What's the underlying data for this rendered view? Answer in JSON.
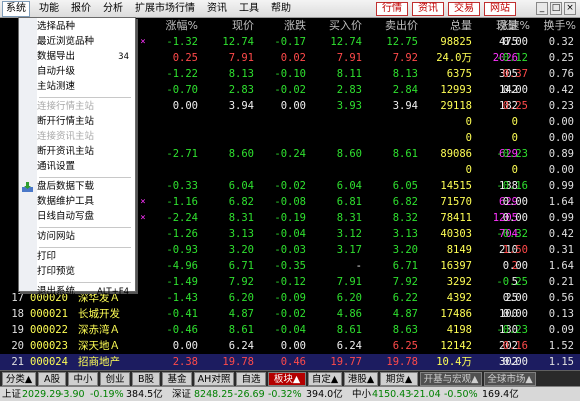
{
  "menubar": {
    "items": [
      "系统",
      "功能",
      "报价",
      "分析",
      "扩展市场行情",
      "资讯",
      "工具",
      "帮助"
    ],
    "quick": [
      "行情",
      "资讯",
      "交易",
      "网站"
    ],
    "window_buttons": [
      "_",
      "□",
      "×"
    ]
  },
  "table": {
    "headers": [
      "涨幅%",
      "现价",
      "涨跌",
      "买入价",
      "卖出价",
      "总量",
      "现量",
      "涨速%",
      "换手%"
    ],
    "rows": [
      {
        "idx": "",
        "code": "",
        "name": "",
        "mark": "×",
        "pct": "-1.32",
        "price": "12.74",
        "chg": "-0.17",
        "bid": "12.74",
        "ask": "12.75",
        "vol": "98825",
        "cur": "475",
        "speed": "0.00",
        "turn": "0.32",
        "colors": {
          "pct": "green",
          "price": "green",
          "chg": "green",
          "bid": "green",
          "ask": "green",
          "cur": "white",
          "speed": "white"
        }
      },
      {
        "idx": "",
        "code": "",
        "name": "",
        "mark": "",
        "pct": "0.25",
        "price": "7.91",
        "chg": "0.02",
        "bid": "7.91",
        "ask": "7.92",
        "vol": "24.0万",
        "cur": "2026",
        "speed": "-0.12",
        "turn": "0.25",
        "colors": {
          "pct": "red",
          "price": "red",
          "chg": "red",
          "bid": "red",
          "ask": "red",
          "cur": "magenta",
          "speed": "green"
        }
      },
      {
        "idx": "",
        "code": "",
        "name": "",
        "mark": "",
        "pct": "-1.22",
        "price": "8.13",
        "chg": "-0.10",
        "bid": "8.11",
        "ask": "8.13",
        "vol": "6375",
        "cur": "305",
        "speed": "0.37",
        "turn": "0.76",
        "colors": {
          "pct": "green",
          "price": "green",
          "chg": "green",
          "bid": "green",
          "ask": "green",
          "cur": "white",
          "speed": "red"
        }
      },
      {
        "idx": "",
        "code": "",
        "name": "",
        "mark": "",
        "pct": "-0.70",
        "price": "2.83",
        "chg": "-0.02",
        "bid": "2.83",
        "ask": "2.84",
        "vol": "12993",
        "cur": "142",
        "speed": "0.00",
        "turn": "0.42",
        "colors": {
          "pct": "green",
          "price": "green",
          "chg": "green",
          "bid": "green",
          "ask": "green",
          "cur": "white",
          "speed": "white"
        }
      },
      {
        "idx": "",
        "code": "",
        "name": "",
        "mark": "",
        "pct": "0.00",
        "price": "3.94",
        "chg": "0.00",
        "bid": "3.93",
        "ask": "3.94",
        "vol": "29118",
        "cur": "182",
        "speed": "0.25",
        "turn": "0.23",
        "colors": {
          "pct": "white",
          "price": "white",
          "chg": "white",
          "bid": "green",
          "ask": "white",
          "cur": "white",
          "speed": "red"
        }
      },
      {
        "idx": "",
        "code": "",
        "name": "",
        "mark": "",
        "pct": "",
        "price": "",
        "chg": "",
        "bid": "",
        "ask": "",
        "vol": "0",
        "cur": "0",
        "speed": "",
        "turn": "0.00",
        "colors": {
          "cur": "yellow"
        }
      },
      {
        "idx": "",
        "code": "",
        "name": "",
        "mark": "",
        "pct": "",
        "price": "",
        "chg": "",
        "bid": "",
        "ask": "",
        "vol": "0",
        "cur": "0",
        "speed": "",
        "turn": "0.00",
        "colors": {
          "cur": "yellow"
        }
      },
      {
        "idx": "",
        "code": "",
        "name": "",
        "mark": "",
        "pct": "-2.71",
        "price": "8.60",
        "chg": "-0.24",
        "bid": "8.60",
        "ask": "8.61",
        "vol": "89086",
        "cur": "629",
        "speed": "-0.23",
        "turn": "0.89",
        "colors": {
          "pct": "green",
          "price": "green",
          "chg": "green",
          "bid": "green",
          "ask": "green",
          "cur": "magenta",
          "speed": "green"
        }
      },
      {
        "idx": "",
        "code": "",
        "name": "",
        "mark": "",
        "pct": "",
        "price": "",
        "chg": "",
        "bid": "",
        "ask": "",
        "vol": "0",
        "cur": "0",
        "speed": "",
        "turn": "0.00",
        "colors": {
          "cur": "yellow"
        }
      },
      {
        "idx": "",
        "code": "",
        "name": "",
        "mark": "",
        "pct": "-0.33",
        "price": "6.04",
        "chg": "-0.02",
        "bid": "6.04",
        "ask": "6.05",
        "vol": "14515",
        "cur": "138",
        "speed": "-0.16",
        "turn": "0.99",
        "colors": {
          "pct": "green",
          "price": "green",
          "chg": "green",
          "bid": "green",
          "ask": "green",
          "cur": "white",
          "speed": "green"
        }
      },
      {
        "idx": "",
        "code": "",
        "name": "",
        "mark": "×",
        "pct": "-1.16",
        "price": "6.82",
        "chg": "-0.08",
        "bid": "6.81",
        "ask": "6.82",
        "vol": "71570",
        "cur": "629",
        "speed": "0.00",
        "turn": "1.64",
        "colors": {
          "pct": "green",
          "price": "green",
          "chg": "green",
          "bid": "green",
          "ask": "green",
          "cur": "magenta",
          "speed": "white"
        }
      },
      {
        "idx": "",
        "code": "",
        "name": "",
        "mark": "×",
        "pct": "-2.24",
        "price": "8.31",
        "chg": "-0.19",
        "bid": "8.31",
        "ask": "8.32",
        "vol": "78411",
        "cur": "1205",
        "speed": "0.00",
        "turn": "0.99",
        "colors": {
          "pct": "green",
          "price": "green",
          "chg": "green",
          "bid": "green",
          "ask": "green",
          "cur": "magenta",
          "speed": "white"
        }
      },
      {
        "idx": "",
        "code": "",
        "name": "",
        "mark": "",
        "pct": "-1.26",
        "price": "3.13",
        "chg": "-0.04",
        "bid": "3.12",
        "ask": "3.13",
        "vol": "40303",
        "cur": "704",
        "speed": "-0.32",
        "turn": "0.42",
        "colors": {
          "pct": "green",
          "price": "green",
          "chg": "green",
          "bid": "green",
          "ask": "green",
          "cur": "magenta",
          "speed": "green"
        }
      },
      {
        "idx": "",
        "code": "",
        "name": "",
        "mark": "",
        "pct": "-0.93",
        "price": "3.20",
        "chg": "-0.03",
        "bid": "3.17",
        "ask": "3.20",
        "vol": "8149",
        "cur": "210",
        "speed": "1.50",
        "turn": "0.31",
        "colors": {
          "pct": "green",
          "price": "green",
          "chg": "green",
          "bid": "green",
          "ask": "green",
          "cur": "white",
          "speed": "red"
        }
      },
      {
        "idx": "",
        "code": "",
        "name": "",
        "mark": "",
        "pct": "-4.96",
        "price": "6.71",
        "chg": "-0.35",
        "bid": "-",
        "ask": "6.71",
        "vol": "16397",
        "cur": "2",
        "speed": "0.00",
        "turn": "1.64",
        "colors": {
          "pct": "green",
          "price": "green",
          "chg": "green",
          "bid": "white",
          "ask": "green",
          "cur": "red",
          "speed": "white"
        }
      },
      {
        "idx": "",
        "code": "",
        "name": "",
        "mark": "",
        "pct": "-1.49",
        "price": "7.92",
        "chg": "-0.12",
        "bid": "7.91",
        "ask": "7.92",
        "vol": "3292",
        "cur": "5",
        "speed": "-0.25",
        "turn": "0.21",
        "colors": {
          "pct": "green",
          "price": "green",
          "chg": "green",
          "bid": "green",
          "ask": "green",
          "cur": "white",
          "speed": "green"
        }
      },
      {
        "idx": "17",
        "code": "000020",
        "name": "深华发Ａ",
        "mark": "",
        "pct": "-1.43",
        "price": "6.20",
        "chg": "-0.09",
        "bid": "6.20",
        "ask": "6.22",
        "vol": "4392",
        "cur": "25",
        "speed": "0.00",
        "turn": "0.56",
        "colors": {
          "pct": "green",
          "price": "green",
          "chg": "green",
          "bid": "green",
          "ask": "green",
          "cur": "white",
          "speed": "white"
        }
      },
      {
        "idx": "18",
        "code": "000021",
        "name": "长城开发",
        "mark": "",
        "pct": "-0.41",
        "price": "4.87",
        "chg": "-0.02",
        "bid": "4.86",
        "ask": "4.87",
        "vol": "17486",
        "cur": "100",
        "speed": "0.00",
        "turn": "0.13",
        "colors": {
          "pct": "green",
          "price": "green",
          "chg": "green",
          "bid": "green",
          "ask": "green",
          "cur": "white",
          "speed": "white"
        }
      },
      {
        "idx": "19",
        "code": "000022",
        "name": "深赤湾Ａ",
        "mark": "",
        "pct": "-0.46",
        "price": "8.61",
        "chg": "-0.04",
        "bid": "8.61",
        "ask": "8.63",
        "vol": "4198",
        "cur": "130",
        "speed": "-0.23",
        "turn": "0.09",
        "colors": {
          "pct": "green",
          "price": "green",
          "chg": "green",
          "bid": "green",
          "ask": "green",
          "cur": "white",
          "speed": "green"
        }
      },
      {
        "idx": "20",
        "code": "000023",
        "name": "深天地Ａ",
        "mark": "",
        "pct": "0.00",
        "price": "6.24",
        "chg": "0.00",
        "bid": "6.24",
        "ask": "6.25",
        "vol": "12142",
        "cur": "202",
        "speed": "0.16",
        "turn": "1.52",
        "colors": {
          "pct": "white",
          "price": "white",
          "chg": "white",
          "bid": "white",
          "ask": "red",
          "cur": "white",
          "speed": "red"
        }
      },
      {
        "idx": "21",
        "code": "000024",
        "name": "招商地产",
        "mark": "",
        "pct": "2.38",
        "price": "19.78",
        "chg": "0.46",
        "bid": "19.77",
        "ask": "19.78",
        "vol": "10.4万",
        "cur": "302",
        "speed": "0.00",
        "turn": "1.15",
        "colors": {
          "pct": "red",
          "price": "red",
          "chg": "red",
          "bid": "red",
          "ask": "red",
          "cur": "white",
          "speed": "white"
        }
      }
    ]
  },
  "dropdown": {
    "items": [
      {
        "label": "选择品种",
        "shortcut": "",
        "disabled": false,
        "icon": ""
      },
      {
        "label": "最近浏览品种",
        "shortcut": "",
        "disabled": false,
        "icon": ""
      },
      {
        "label": "数据导出",
        "shortcut": "34",
        "disabled": false,
        "icon": ""
      },
      {
        "label": "自动升级",
        "shortcut": "",
        "disabled": false,
        "icon": ""
      },
      {
        "label": "主站测速",
        "shortcut": "",
        "disabled": false,
        "icon": ""
      },
      {
        "sep": true
      },
      {
        "label": "连接行情主站",
        "shortcut": "",
        "disabled": true,
        "icon": ""
      },
      {
        "label": "断开行情主站",
        "shortcut": "",
        "disabled": false,
        "icon": ""
      },
      {
        "label": "连接资讯主站",
        "shortcut": "",
        "disabled": true,
        "icon": ""
      },
      {
        "label": "断开资讯主站",
        "shortcut": "",
        "disabled": false,
        "icon": ""
      },
      {
        "label": "通讯设置",
        "shortcut": "",
        "disabled": false,
        "icon": ""
      },
      {
        "sep": true
      },
      {
        "label": "盘后数据下载",
        "shortcut": "",
        "disabled": false,
        "icon": "download"
      },
      {
        "label": "数据维护工具",
        "shortcut": "",
        "disabled": false,
        "icon": ""
      },
      {
        "label": "日线自动写盘",
        "shortcut": "",
        "disabled": false,
        "icon": ""
      },
      {
        "sep": true
      },
      {
        "label": "访问网站",
        "shortcut": "",
        "disabled": false,
        "icon": ""
      },
      {
        "sep": true
      },
      {
        "label": "打印",
        "shortcut": "",
        "disabled": false,
        "icon": ""
      },
      {
        "label": "打印预览",
        "shortcut": "",
        "disabled": false,
        "icon": ""
      },
      {
        "sep": true
      },
      {
        "label": "退出系统",
        "shortcut": "ALT+F4",
        "disabled": false,
        "icon": ""
      }
    ]
  },
  "tabs": [
    {
      "label": "分类▲",
      "style": ""
    },
    {
      "label": "A股",
      "style": ""
    },
    {
      "label": "中小",
      "style": ""
    },
    {
      "label": "创业",
      "style": ""
    },
    {
      "label": "B股",
      "style": ""
    },
    {
      "label": "基金",
      "style": ""
    },
    {
      "label": "AH对照",
      "style": ""
    },
    {
      "label": "自选",
      "style": ""
    },
    {
      "label": "板块▲",
      "style": "active"
    },
    {
      "label": "自定▲",
      "style": ""
    },
    {
      "label": "港股▲",
      "style": ""
    },
    {
      "label": "期货▲",
      "style": ""
    },
    {
      "label": "开基与宏观▲",
      "style": "dark"
    },
    {
      "label": "全球市场▲",
      "style": "dark"
    }
  ],
  "status": [
    {
      "text": "上证",
      "cls": "st-lbl"
    },
    {
      "text": "2029.29",
      "cls": "st-dn"
    },
    {
      "text": "-3.90",
      "cls": "st-dn"
    },
    {
      "text": "-0.19%",
      "cls": "st-dn"
    },
    {
      "text": "384.5亿",
      "cls": "st-n"
    },
    {
      "text": "深证",
      "cls": "st-lbl"
    },
    {
      "text": "8248.25",
      "cls": "st-dn"
    },
    {
      "text": "-26.69",
      "cls": "st-dn"
    },
    {
      "text": "-0.32%",
      "cls": "st-dn"
    },
    {
      "text": "394.0亿",
      "cls": "st-n"
    },
    {
      "text": "中小",
      "cls": "st-lbl"
    },
    {
      "text": "4150.43",
      "cls": "st-dn"
    },
    {
      "text": "-21.04",
      "cls": "st-dn"
    },
    {
      "text": "-0.50%",
      "cls": "st-dn"
    },
    {
      "text": "169.4亿",
      "cls": "st-n"
    }
  ]
}
